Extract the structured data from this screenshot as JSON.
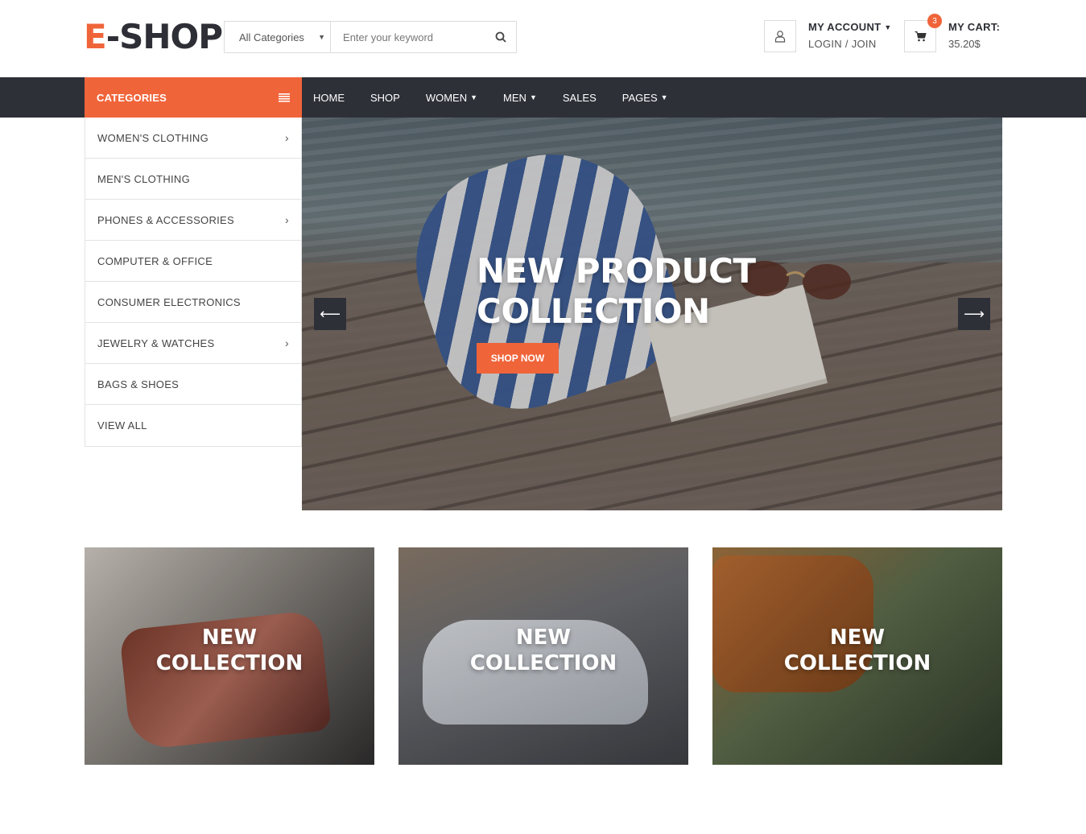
{
  "brand": {
    "logo_first": "E",
    "logo_rest": "-SHOP",
    "accent_color": "#f0643a",
    "dark_color": "#2e3038"
  },
  "search": {
    "category": "All Categories",
    "placeholder": "Enter your keyword",
    "icon": "search-icon"
  },
  "account": {
    "title": "MY ACCOUNT",
    "subtitle": "LOGIN / JOIN",
    "icon": "user-icon"
  },
  "cart": {
    "title": "MY CART:",
    "amount": "35.20$",
    "count": "3",
    "icon": "cart-icon"
  },
  "categories": {
    "heading": "CATEGORIES",
    "items": [
      {
        "label": "WOMEN'S CLOTHING",
        "has_sub": true
      },
      {
        "label": "MEN'S CLOTHING",
        "has_sub": false
      },
      {
        "label": "PHONES & ACCESSORIES",
        "has_sub": true
      },
      {
        "label": "COMPUTER & OFFICE",
        "has_sub": false
      },
      {
        "label": "CONSUMER ELECTRONICS",
        "has_sub": false
      },
      {
        "label": "JEWELRY & WATCHES",
        "has_sub": true
      },
      {
        "label": "BAGS & SHOES",
        "has_sub": false
      },
      {
        "label": "VIEW ALL",
        "has_sub": false
      }
    ]
  },
  "nav": {
    "items": [
      {
        "label": "HOME",
        "dropdown": false
      },
      {
        "label": "SHOP",
        "dropdown": false
      },
      {
        "label": "WOMEN",
        "dropdown": true
      },
      {
        "label": "MEN",
        "dropdown": true
      },
      {
        "label": "SALES",
        "dropdown": false
      },
      {
        "label": "PAGES",
        "dropdown": true
      }
    ]
  },
  "hero": {
    "title_line1": "NEW PRODUCT",
    "title_line2": "COLLECTION",
    "button": "SHOP NOW"
  },
  "collections": [
    {
      "line1": "NEW",
      "line2": "COLLECTION"
    },
    {
      "line1": "NEW",
      "line2": "COLLECTION"
    },
    {
      "line1": "NEW",
      "line2": "COLLECTION"
    }
  ]
}
